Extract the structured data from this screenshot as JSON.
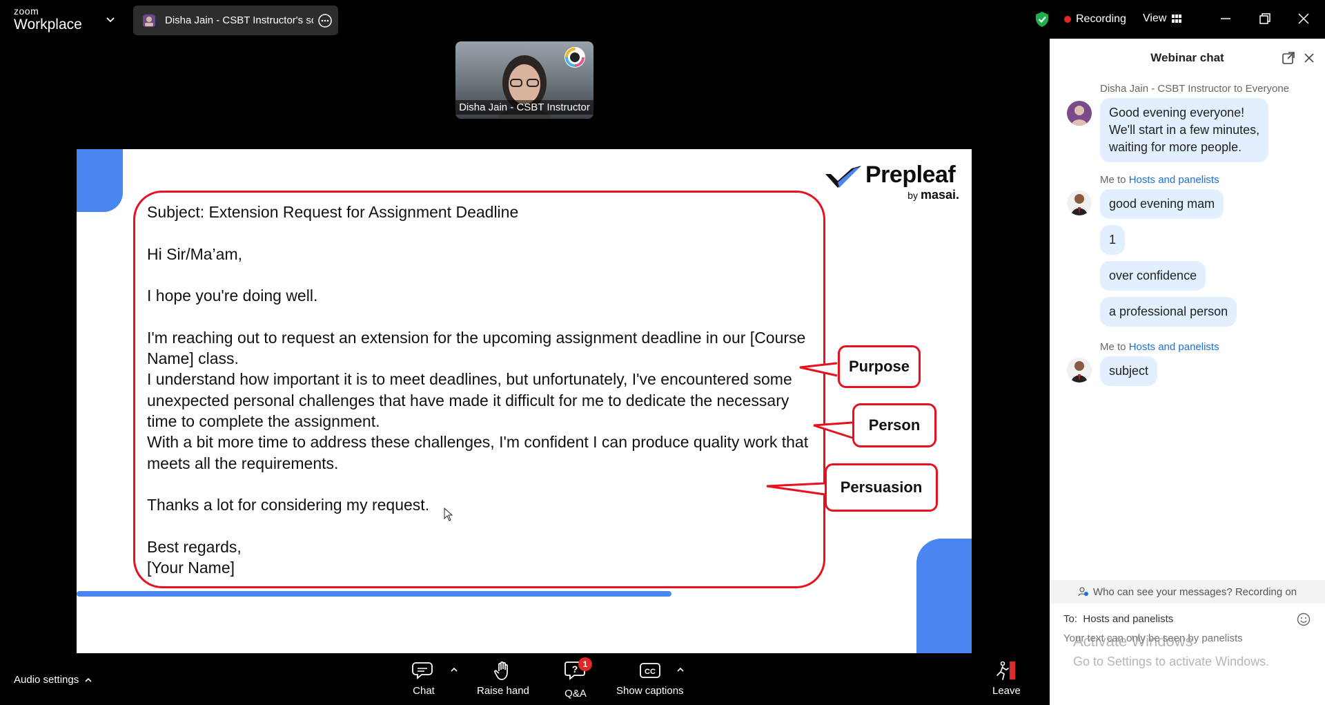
{
  "topbar": {
    "brand_small": "zoom",
    "brand_big": "Workplace",
    "share_tab_label": "Disha Jain - CSBT Instructor's scre",
    "recording_label": "Recording",
    "view_label": "View"
  },
  "presenter": {
    "name": "Disha Jain - CSBT Instructor"
  },
  "slide": {
    "logo_word": "Prepleaf",
    "logo_by": "by",
    "logo_brand": "masai.",
    "letter": {
      "subject": "Subject: Extension Request for Assignment Deadline",
      "greeting": "Hi Sir/Ma’am,",
      "opening": "I hope you're doing well.",
      "para1": "I'm reaching out to request an extension for the upcoming assignment deadline in our [Course Name] class.",
      "para2": "I understand how important it is to meet deadlines, but unfortunately, I've encountered some unexpected personal challenges that have made it difficult for me to dedicate the necessary time to complete the assignment.",
      "para3": "With a bit more time to address these challenges, I'm confident I can produce quality work that meets all the requirements.",
      "thanks": "Thanks a lot for considering my request.",
      "signoff": "Best regards,",
      "name": "[Your Name]"
    },
    "callouts": {
      "purpose": "Purpose",
      "person": "Person",
      "persuasion": "Persuasion"
    },
    "accent_color": "#4a86f0",
    "highlight_color": "#e6101e"
  },
  "chat": {
    "title": "Webinar chat",
    "messages": [
      {
        "sender": "Disha Jain - CSBT Instructor to Everyone",
        "lines": [
          "Good evening everyone!",
          "We'll start in a few minutes,",
          "waiting for more people."
        ]
      },
      {
        "prefix": "Me to ",
        "target": "Hosts and panelists",
        "bubbles": [
          "good evening mam",
          "1",
          "over confidence",
          "a professional person"
        ]
      },
      {
        "prefix": "Me to ",
        "target": "Hosts and panelists",
        "bubbles": [
          "subject"
        ]
      }
    ],
    "visibility_note": "Who can see your messages? Recording on",
    "to_label": "To:",
    "to_value": "Hosts and panelists",
    "compose_placeholder": "Your text can only be seen by panelists",
    "watermark_line1": "Activate Windows",
    "watermark_line2": "Go to Settings to activate Windows."
  },
  "toolbar": {
    "audio_settings": "Audio settings",
    "chat": "Chat",
    "raise_hand": "Raise hand",
    "qa": "Q&A",
    "qa_badge": "1",
    "captions": "Show captions",
    "leave": "Leave"
  }
}
